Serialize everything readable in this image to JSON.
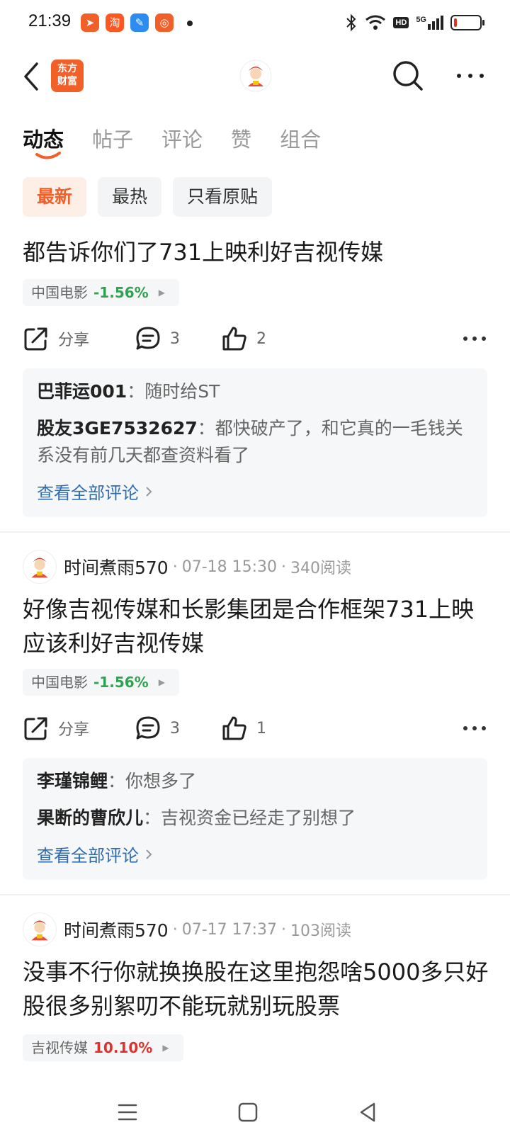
{
  "status_bar": {
    "time": "21:39",
    "hd": "HD",
    "network": "5G",
    "apps": [
      {
        "icon": "telegram-app-icon",
        "glyph": "➤",
        "color": "#f2602a"
      },
      {
        "icon": "taobao-app-icon",
        "glyph": "淘",
        "color": "#ff5722"
      },
      {
        "icon": "blue-app-icon",
        "glyph": "✎",
        "color": "#2d8cf0"
      },
      {
        "icon": "grid-app-icon",
        "glyph": "◎",
        "color": "#f2602a"
      }
    ],
    "battery_level": 0.12
  },
  "header": {
    "brand": "东方\n财富"
  },
  "tabs": [
    {
      "label": "动态",
      "active": true
    },
    {
      "label": "帖子",
      "active": false
    },
    {
      "label": "评论",
      "active": false
    },
    {
      "label": "赞",
      "active": false
    },
    {
      "label": "组合",
      "active": false
    }
  ],
  "filters": [
    {
      "label": "最新",
      "active": true
    },
    {
      "label": "最热",
      "active": false
    },
    {
      "label": "只看原贴",
      "active": false
    }
  ],
  "colors": {
    "accent": "#f2602a",
    "down": "#2ea44f",
    "up": "#e0322c",
    "link": "#2e6db5"
  },
  "posts": [
    {
      "title": "都告诉你们了731上映利好吉视传媒",
      "stock": {
        "name": "中国电影",
        "change": "-1.56%",
        "direction": "down"
      },
      "share_label": "分享",
      "comment_count": "3",
      "like_count": "2",
      "comments": [
        {
          "author": "巴菲运001",
          "sep": "：",
          "text": "随时给ST"
        },
        {
          "author": "股友3GE7532627",
          "sep": "：",
          "text": "都快破产了，和它真的一毛钱关系没有前几天都查资料看了"
        }
      ],
      "view_all": "查看全部评论"
    },
    {
      "author": "时间煮雨570",
      "time": "07-18 15:30",
      "reads": "340阅读",
      "title": "好像吉视传媒和长影集团是合作框架731上映应该利好吉视传媒",
      "stock": {
        "name": "中国电影",
        "change": "-1.56%",
        "direction": "down"
      },
      "share_label": "分享",
      "comment_count": "3",
      "like_count": "1",
      "comments": [
        {
          "author": "李瑾锦鲤",
          "sep": "：",
          "text": "你想多了"
        },
        {
          "author": "果断的曹欣儿",
          "sep": "：",
          "text": "吉视资金已经走了别想了"
        }
      ],
      "view_all": "查看全部评论"
    },
    {
      "author": "时间煮雨570",
      "time": "07-17 17:37",
      "reads": "103阅读",
      "title": "没事不行你就换换股在这里抱怨啥5000多只好股很多别絮叨不能玩就别玩股票",
      "stock": {
        "name": "吉视传媒",
        "change": "10.10%",
        "direction": "up"
      }
    }
  ],
  "meta_sep": "·"
}
